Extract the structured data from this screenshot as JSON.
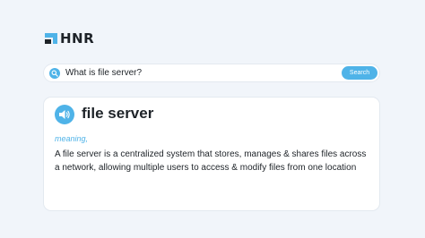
{
  "logo": {
    "text": "HNR",
    "icon": "hnr-logo-mark"
  },
  "search": {
    "query": "What is file server?",
    "button_label": "Search",
    "icon": "search-icon"
  },
  "result": {
    "term": "file server",
    "speaker_icon": "speaker-icon",
    "meaning_label": "meaning,",
    "definition": "A file server is a centralized system that stores, manages & shares files across a network, allowing multiple users to access & modify files from one location"
  },
  "colors": {
    "accent": "#4fb3e8",
    "background": "#f1f5fa",
    "text": "#1e2328"
  }
}
